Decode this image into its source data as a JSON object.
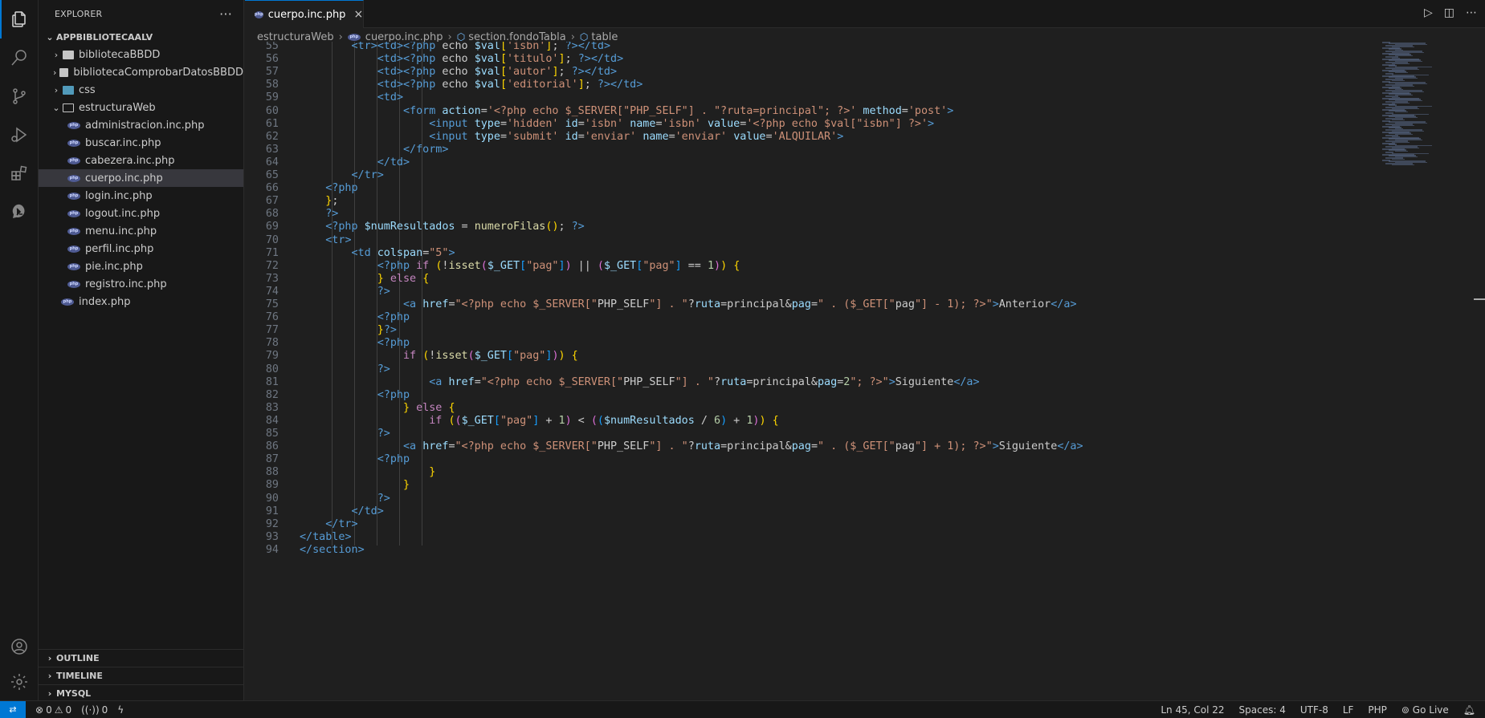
{
  "explorer": {
    "header": "EXPLORER",
    "more": "···",
    "project": "APPBIBLIOTECAALV",
    "items": [
      {
        "label": "bibliotecaBBDD",
        "type": "folder"
      },
      {
        "label": "bibliotecaComprobarDatosBBDD",
        "type": "folder"
      },
      {
        "label": "css",
        "type": "folder-css"
      },
      {
        "label": "estructuraWeb",
        "type": "folder-open"
      },
      {
        "label": "administracion.inc.php",
        "type": "php"
      },
      {
        "label": "buscar.inc.php",
        "type": "php"
      },
      {
        "label": "cabezera.inc.php",
        "type": "php"
      },
      {
        "label": "cuerpo.inc.php",
        "type": "php"
      },
      {
        "label": "login.inc.php",
        "type": "php"
      },
      {
        "label": "logout.inc.php",
        "type": "php"
      },
      {
        "label": "menu.inc.php",
        "type": "php"
      },
      {
        "label": "perfil.inc.php",
        "type": "php"
      },
      {
        "label": "pie.inc.php",
        "type": "php"
      },
      {
        "label": "registro.inc.php",
        "type": "php"
      },
      {
        "label": "index.php",
        "type": "php"
      }
    ],
    "outline": "OUTLINE",
    "timeline": "TIMELINE",
    "mysql": "MYSQL"
  },
  "tab": {
    "label": "cuerpo.inc.php",
    "close": "×"
  },
  "breadcrumb": {
    "folder": "estructuraWeb",
    "file": "cuerpo.inc.php",
    "section": "section.fondoTabla",
    "table": "table"
  },
  "code_lines": [
    {
      "n": "55",
      "t": "        <tr><td><?php echo $val['isbn']; ?></td>"
    },
    {
      "n": "56",
      "t": "            <td><?php echo $val['titulo']; ?></td>"
    },
    {
      "n": "57",
      "t": "            <td><?php echo $val['autor']; ?></td>"
    },
    {
      "n": "58",
      "t": "            <td><?php echo $val['editorial']; ?></td>"
    },
    {
      "n": "59",
      "t": "            <td>"
    },
    {
      "n": "60",
      "t": "                <form action='<?php echo $_SERVER[\"PHP_SELF\"] . \"?ruta=principal\"; ?>' method='post'>"
    },
    {
      "n": "61",
      "t": "                    <input type='hidden' id='isbn' name='isbn' value='<?php echo $val[\"isbn\"] ?>'>"
    },
    {
      "n": "62",
      "t": "                    <input type='submit' id='enviar' name='enviar' value='ALQUILAR'>"
    },
    {
      "n": "63",
      "t": "                </form>"
    },
    {
      "n": "64",
      "t": "            </td>"
    },
    {
      "n": "65",
      "t": "        </tr>"
    },
    {
      "n": "66",
      "t": "    <?php"
    },
    {
      "n": "67",
      "t": "    };"
    },
    {
      "n": "68",
      "t": "    ?>"
    },
    {
      "n": "69",
      "t": "    <?php $numResultados = numeroFilas(); ?>"
    },
    {
      "n": "70",
      "t": "    <tr>"
    },
    {
      "n": "71",
      "t": "        <td colspan=\"5\">"
    },
    {
      "n": "72",
      "t": "            <?php if (!isset($_GET[\"pag\"]) || ($_GET[\"pag\"] == 1)) {"
    },
    {
      "n": "73",
      "t": "            } else {"
    },
    {
      "n": "74",
      "t": "            ?>"
    },
    {
      "n": "75",
      "t": "                <a href=\"<?php echo $_SERVER[\"PHP_SELF\"] . \"?ruta=principal&pag=\" . ($_GET[\"pag\"] - 1); ?>\">Anterior</a>"
    },
    {
      "n": "76",
      "t": "            <?php"
    },
    {
      "n": "77",
      "t": "            }?>"
    },
    {
      "n": "78",
      "t": "            <?php"
    },
    {
      "n": "79",
      "t": "                if (!isset($_GET[\"pag\"])) {"
    },
    {
      "n": "80",
      "t": "            ?>"
    },
    {
      "n": "81",
      "t": "                    <a href=\"<?php echo $_SERVER[\"PHP_SELF\"] . \"?ruta=principal&pag=2\"; ?>\">Siguiente</a>"
    },
    {
      "n": "82",
      "t": "            <?php"
    },
    {
      "n": "83",
      "t": "                } else {"
    },
    {
      "n": "84",
      "t": "                    if (($_GET[\"pag\"] + 1) < (($numResultados / 6) + 1)) {"
    },
    {
      "n": "85",
      "t": "            ?>"
    },
    {
      "n": "86",
      "t": "                <a href=\"<?php echo $_SERVER[\"PHP_SELF\"] . \"?ruta=principal&pag=\" . ($_GET[\"pag\"] + 1); ?>\">Siguiente</a>"
    },
    {
      "n": "87",
      "t": "            <?php"
    },
    {
      "n": "88",
      "t": "                    }"
    },
    {
      "n": "89",
      "t": "                }"
    },
    {
      "n": "90",
      "t": "            ?>"
    },
    {
      "n": "91",
      "t": "        </td>"
    },
    {
      "n": "92",
      "t": "    </tr>"
    },
    {
      "n": "93",
      "t": "</table>"
    },
    {
      "n": "94",
      "t": "</section>"
    }
  ],
  "status": {
    "errors": "0",
    "warnings": "0",
    "ports": "0",
    "position": "Ln 45, Col 22",
    "spaces": "Spaces: 4",
    "encoding": "UTF-8",
    "eol": "LF",
    "language": "PHP",
    "golive": "Go Live"
  },
  "colors": {
    "accent": "#0078d4",
    "tag": "#569cd6",
    "attribute": "#9cdcfe",
    "string": "#ce9178",
    "keyword": "#c586c0",
    "function": "#dcdcaa"
  }
}
